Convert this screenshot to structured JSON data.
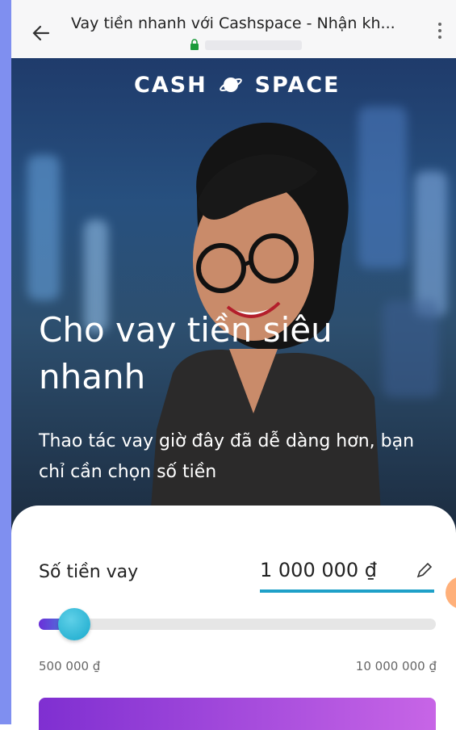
{
  "browser": {
    "title": "Vay tiền nhanh với Cashspace - Nhận kh...",
    "back_icon": "arrow-left-icon",
    "lock_icon": "lock-icon",
    "menu_icon": "more-vertical-icon"
  },
  "hero": {
    "logo_left": "CASH",
    "logo_right": "SPACE",
    "title": "Cho vay tiền siêu nhanh",
    "subtitle": "Thao tác vay giờ đây đã dễ dàng hơn, bạn chỉ cần chọn số tiền"
  },
  "loan": {
    "amount_label": "Số tiền vay",
    "amount_value": "1 000 000 ₫",
    "min_label": "500 000 ₫",
    "max_label": "10 000 000 ₫",
    "edit_icon": "pencil-icon"
  },
  "colors": {
    "accent": "#1ea0c8",
    "cta_start": "#7f2fd1",
    "cta_end": "#c765e6"
  }
}
